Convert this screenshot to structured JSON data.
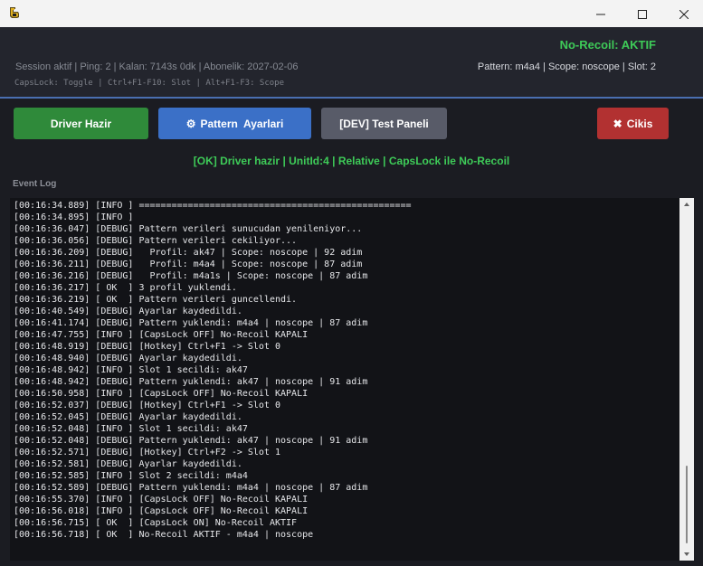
{
  "window": {
    "icons": {
      "app": "app-logo-icon",
      "minimize": "minimize-icon",
      "maximize": "maximize-icon",
      "close": "close-icon"
    }
  },
  "header": {
    "status_title": "No-Recoil: AKTIF",
    "session_info": "Session aktif | Ping: 2 | Kalan: 7143s 0dk | Abonelik: 2027-02-06",
    "pattern_info": "Pattern: m4a4 | Scope: noscope | Slot: 2",
    "hotkey_hint": "CapsLock: Toggle | Ctrl+F1-F10: Slot | Alt+F1-F3: Scope"
  },
  "toolbar": {
    "driver_label": "Driver Hazir",
    "pattern_label": "Pattern  Ayarlari",
    "dev_label": "[DEV] Test Paneli",
    "exit_label": "Cikis",
    "icons": {
      "pattern": "gear-icon",
      "exit": "close-x-icon"
    }
  },
  "status_line": "[OK] Driver hazir | UnitId:4 | Relative | CapsLock ile No-Recoil",
  "event_log": {
    "title": "Event Log",
    "lines": [
      "[00:16:34.889] [INFO ] ==================================================",
      "[00:16:34.895] [INFO ]",
      "[00:16:36.047] [DEBUG] Pattern verileri sunucudan yenileniyor...",
      "[00:16:36.056] [DEBUG] Pattern verileri cekiliyor...",
      "[00:16:36.209] [DEBUG]   Profil: ak47 | Scope: noscope | 92 adim",
      "[00:16:36.211] [DEBUG]   Profil: m4a4 | Scope: noscope | 87 adim",
      "[00:16:36.216] [DEBUG]   Profil: m4a1s | Scope: noscope | 87 adim",
      "[00:16:36.217] [ OK  ] 3 profil yuklendi.",
      "[00:16:36.219] [ OK  ] Pattern verileri guncellendi.",
      "[00:16:40.549] [DEBUG] Ayarlar kaydedildi.",
      "[00:16:41.174] [DEBUG] Pattern yuklendi: m4a4 | noscope | 87 adim",
      "[00:16:47.755] [INFO ] [CapsLock OFF] No-Recoil KAPALI",
      "[00:16:48.919] [DEBUG] [Hotkey] Ctrl+F1 -> Slot 0",
      "[00:16:48.940] [DEBUG] Ayarlar kaydedildi.",
      "[00:16:48.942] [INFO ] Slot 1 secildi: ak47",
      "[00:16:48.942] [DEBUG] Pattern yuklendi: ak47 | noscope | 91 adim",
      "[00:16:50.958] [INFO ] [CapsLock OFF] No-Recoil KAPALI",
      "[00:16:52.037] [DEBUG] [Hotkey] Ctrl+F1 -> Slot 0",
      "[00:16:52.045] [DEBUG] Ayarlar kaydedildi.",
      "[00:16:52.048] [INFO ] Slot 1 secildi: ak47",
      "[00:16:52.048] [DEBUG] Pattern yuklendi: ak47 | noscope | 91 adim",
      "[00:16:52.571] [DEBUG] [Hotkey] Ctrl+F2 -> Slot 1",
      "[00:16:52.581] [DEBUG] Ayarlar kaydedildi.",
      "[00:16:52.585] [INFO ] Slot 2 secildi: m4a4",
      "[00:16:52.589] [DEBUG] Pattern yuklendi: m4a4 | noscope | 87 adim",
      "[00:16:55.370] [INFO ] [CapsLock OFF] No-Recoil KAPALI",
      "[00:16:56.018] [INFO ] [CapsLock OFF] No-Recoil KAPALI",
      "[00:16:56.715] [ OK  ] [CapsLock ON] No-Recoil AKTIF",
      "[00:16:56.718] [ OK  ] No-Recoil AKTIF - m4a4 | noscope"
    ]
  },
  "colors": {
    "accent_green": "#3ecb58",
    "driver_button": "#2f8a3a",
    "pattern_button": "#3b70c7",
    "dev_button": "#585b68",
    "exit_button": "#b23131",
    "header_line": "#4a6fb1"
  }
}
